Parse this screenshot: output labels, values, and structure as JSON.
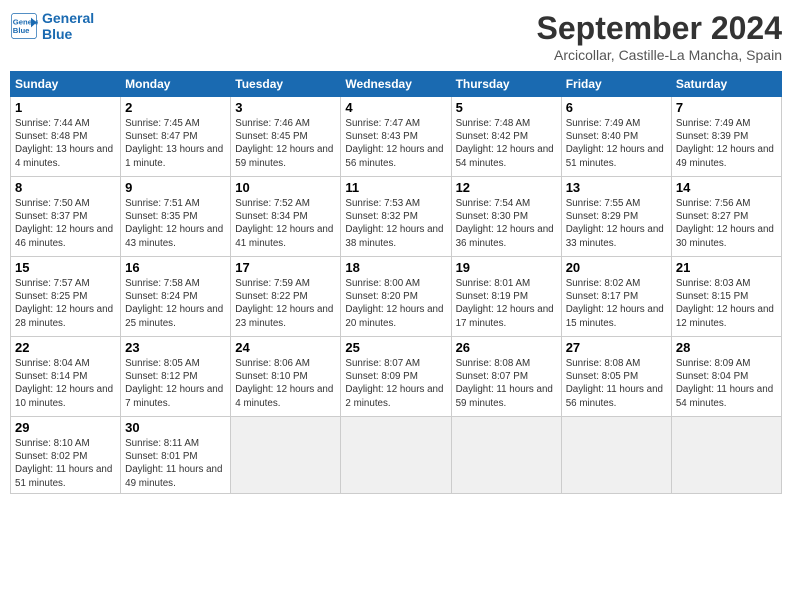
{
  "header": {
    "logo_line1": "General",
    "logo_line2": "Blue",
    "month_year": "September 2024",
    "location": "Arcicollar, Castille-La Mancha, Spain"
  },
  "weekdays": [
    "Sunday",
    "Monday",
    "Tuesday",
    "Wednesday",
    "Thursday",
    "Friday",
    "Saturday"
  ],
  "weeks": [
    [
      {
        "day": "1",
        "sunrise": "7:44 AM",
        "sunset": "8:48 PM",
        "daylight": "13 hours and 4 minutes."
      },
      {
        "day": "2",
        "sunrise": "7:45 AM",
        "sunset": "8:47 PM",
        "daylight": "13 hours and 1 minute."
      },
      {
        "day": "3",
        "sunrise": "7:46 AM",
        "sunset": "8:45 PM",
        "daylight": "12 hours and 59 minutes."
      },
      {
        "day": "4",
        "sunrise": "7:47 AM",
        "sunset": "8:43 PM",
        "daylight": "12 hours and 56 minutes."
      },
      {
        "day": "5",
        "sunrise": "7:48 AM",
        "sunset": "8:42 PM",
        "daylight": "12 hours and 54 minutes."
      },
      {
        "day": "6",
        "sunrise": "7:49 AM",
        "sunset": "8:40 PM",
        "daylight": "12 hours and 51 minutes."
      },
      {
        "day": "7",
        "sunrise": "7:49 AM",
        "sunset": "8:39 PM",
        "daylight": "12 hours and 49 minutes."
      }
    ],
    [
      {
        "day": "8",
        "sunrise": "7:50 AM",
        "sunset": "8:37 PM",
        "daylight": "12 hours and 46 minutes."
      },
      {
        "day": "9",
        "sunrise": "7:51 AM",
        "sunset": "8:35 PM",
        "daylight": "12 hours and 43 minutes."
      },
      {
        "day": "10",
        "sunrise": "7:52 AM",
        "sunset": "8:34 PM",
        "daylight": "12 hours and 41 minutes."
      },
      {
        "day": "11",
        "sunrise": "7:53 AM",
        "sunset": "8:32 PM",
        "daylight": "12 hours and 38 minutes."
      },
      {
        "day": "12",
        "sunrise": "7:54 AM",
        "sunset": "8:30 PM",
        "daylight": "12 hours and 36 minutes."
      },
      {
        "day": "13",
        "sunrise": "7:55 AM",
        "sunset": "8:29 PM",
        "daylight": "12 hours and 33 minutes."
      },
      {
        "day": "14",
        "sunrise": "7:56 AM",
        "sunset": "8:27 PM",
        "daylight": "12 hours and 30 minutes."
      }
    ],
    [
      {
        "day": "15",
        "sunrise": "7:57 AM",
        "sunset": "8:25 PM",
        "daylight": "12 hours and 28 minutes."
      },
      {
        "day": "16",
        "sunrise": "7:58 AM",
        "sunset": "8:24 PM",
        "daylight": "12 hours and 25 minutes."
      },
      {
        "day": "17",
        "sunrise": "7:59 AM",
        "sunset": "8:22 PM",
        "daylight": "12 hours and 23 minutes."
      },
      {
        "day": "18",
        "sunrise": "8:00 AM",
        "sunset": "8:20 PM",
        "daylight": "12 hours and 20 minutes."
      },
      {
        "day": "19",
        "sunrise": "8:01 AM",
        "sunset": "8:19 PM",
        "daylight": "12 hours and 17 minutes."
      },
      {
        "day": "20",
        "sunrise": "8:02 AM",
        "sunset": "8:17 PM",
        "daylight": "12 hours and 15 minutes."
      },
      {
        "day": "21",
        "sunrise": "8:03 AM",
        "sunset": "8:15 PM",
        "daylight": "12 hours and 12 minutes."
      }
    ],
    [
      {
        "day": "22",
        "sunrise": "8:04 AM",
        "sunset": "8:14 PM",
        "daylight": "12 hours and 10 minutes."
      },
      {
        "day": "23",
        "sunrise": "8:05 AM",
        "sunset": "8:12 PM",
        "daylight": "12 hours and 7 minutes."
      },
      {
        "day": "24",
        "sunrise": "8:06 AM",
        "sunset": "8:10 PM",
        "daylight": "12 hours and 4 minutes."
      },
      {
        "day": "25",
        "sunrise": "8:07 AM",
        "sunset": "8:09 PM",
        "daylight": "12 hours and 2 minutes."
      },
      {
        "day": "26",
        "sunrise": "8:08 AM",
        "sunset": "8:07 PM",
        "daylight": "11 hours and 59 minutes."
      },
      {
        "day": "27",
        "sunrise": "8:08 AM",
        "sunset": "8:05 PM",
        "daylight": "11 hours and 56 minutes."
      },
      {
        "day": "28",
        "sunrise": "8:09 AM",
        "sunset": "8:04 PM",
        "daylight": "11 hours and 54 minutes."
      }
    ],
    [
      {
        "day": "29",
        "sunrise": "8:10 AM",
        "sunset": "8:02 PM",
        "daylight": "11 hours and 51 minutes."
      },
      {
        "day": "30",
        "sunrise": "8:11 AM",
        "sunset": "8:01 PM",
        "daylight": "11 hours and 49 minutes."
      },
      null,
      null,
      null,
      null,
      null
    ]
  ]
}
